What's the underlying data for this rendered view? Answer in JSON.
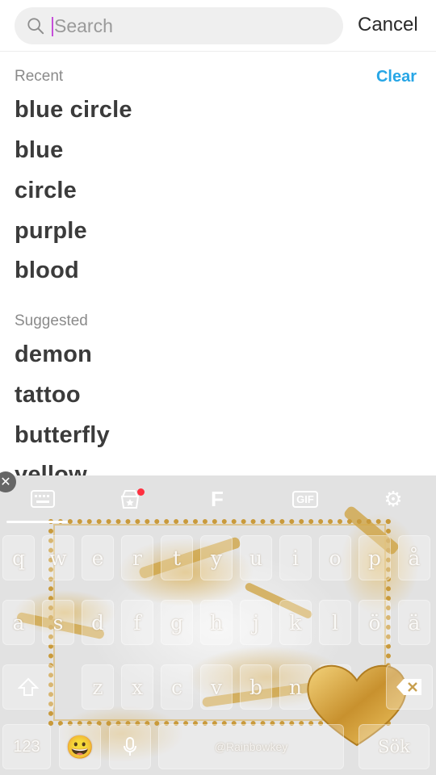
{
  "search": {
    "placeholder": "Search",
    "value": "",
    "cancel_label": "Cancel"
  },
  "recent": {
    "header": "Recent",
    "clear_label": "Clear",
    "items": [
      "blue circle",
      "blue",
      "circle",
      "purple",
      "blood"
    ]
  },
  "suggested": {
    "header": "Suggested",
    "items": [
      "demon",
      "tattoo",
      "butterfly",
      "yellow"
    ]
  },
  "keyboard": {
    "toolbar": {
      "keyboard_icon": "keyboard-icon",
      "store_icon": "store-icon",
      "font_label": "F",
      "gif_label": "GIF",
      "settings_icon": "gear-icon"
    },
    "rows": [
      [
        "q",
        "w",
        "e",
        "r",
        "t",
        "y",
        "u",
        "i",
        "o",
        "p",
        "å"
      ],
      [
        "a",
        "s",
        "d",
        "f",
        "g",
        "h",
        "j",
        "k",
        "l",
        "ö",
        "ä"
      ],
      [
        "z",
        "x",
        "c",
        "v",
        "b",
        "n",
        "m"
      ]
    ],
    "numbers_label": "123",
    "emoji": "😀",
    "space_label": "@Rainbowkey",
    "action_label": "Sök"
  },
  "colors": {
    "accent": "#27a6e6",
    "caret": "#c54fd9",
    "gold": "#d8ac4e"
  }
}
